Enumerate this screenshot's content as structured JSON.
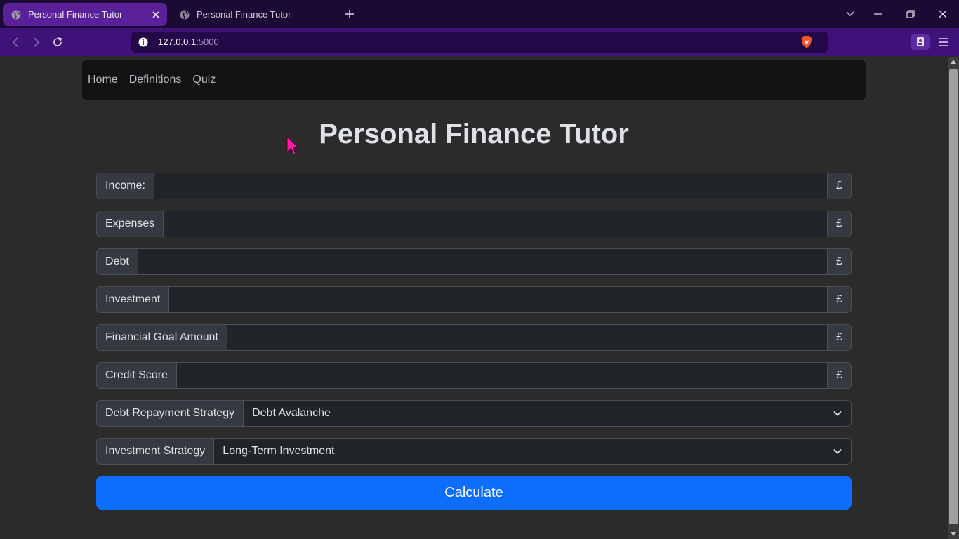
{
  "browser": {
    "tabs": [
      {
        "title": "Personal Finance Tutor",
        "active": true
      },
      {
        "title": "Personal Finance Tutor",
        "active": false
      }
    ],
    "url_host": "127.0.0.1",
    "url_port": ":5000"
  },
  "navbar": {
    "links": [
      "Home",
      "Definitions",
      "Quiz"
    ]
  },
  "page": {
    "title": "Personal Finance Tutor"
  },
  "form": {
    "fields": [
      {
        "label": "Income:",
        "value": "",
        "suffix": "£"
      },
      {
        "label": "Expenses",
        "value": "",
        "suffix": "£"
      },
      {
        "label": "Debt",
        "value": "",
        "suffix": "£"
      },
      {
        "label": "Investment",
        "value": "",
        "suffix": "£"
      },
      {
        "label": "Financial Goal Amount",
        "value": "",
        "suffix": "£"
      },
      {
        "label": "Credit Score",
        "value": "",
        "suffix": "£"
      }
    ],
    "selects": [
      {
        "label": "Debt Repayment Strategy",
        "value": "Debt Avalanche"
      },
      {
        "label": "Investment Strategy",
        "value": "Long-Term Investment"
      }
    ],
    "submit_label": "Calculate"
  },
  "colors": {
    "accent": "#0d6efd",
    "tab_active": "#5a2099",
    "toolbar": "#3f127a",
    "cursor": "#ff1aa8"
  }
}
